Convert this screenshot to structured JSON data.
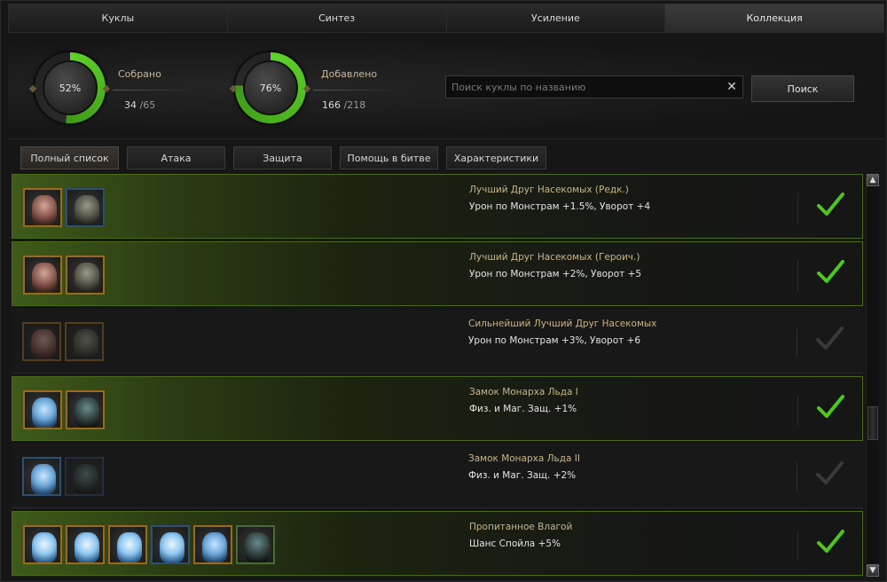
{
  "tabs": [
    {
      "label": "Куклы"
    },
    {
      "label": "Синтез"
    },
    {
      "label": "Усиление"
    },
    {
      "label": "Коллекция"
    }
  ],
  "stats": {
    "collected": {
      "percent_label": "52%",
      "label": "Собрано",
      "current": "34",
      "total": "/65",
      "fraction": 0.52
    },
    "added": {
      "percent_label": "76%",
      "label": "Добавлено",
      "current": "166",
      "total": "/218",
      "fraction": 0.76
    }
  },
  "search": {
    "placeholder": "Поиск куклы по названию",
    "value": "",
    "button_label": "Поиск",
    "clear_glyph": "✕"
  },
  "filters": [
    {
      "label": "Полный список"
    },
    {
      "label": "Атака"
    },
    {
      "label": "Защита"
    },
    {
      "label": "Помощь в битве"
    },
    {
      "label": "Характеристики"
    }
  ],
  "colors": {
    "accent_green": "#4b6a1c",
    "check_active": "#4ec81e",
    "title_gold": "#c9b48a"
  },
  "collections": [
    {
      "title": "Лучший Друг Насекомых (Редк.)",
      "desc": "Урон по Монстрам +1.5%, Уворот +4",
      "complete": true,
      "icons": [
        {
          "type": "bug",
          "frame": "gold"
        },
        {
          "type": "bug2",
          "frame": "blue"
        }
      ]
    },
    {
      "title": "Лучший Друг Насекомых (Героич.)",
      "desc": "Урон по Монстрам +2%, Уворот +5",
      "complete": true,
      "icons": [
        {
          "type": "bug",
          "frame": "gold"
        },
        {
          "type": "bug2",
          "frame": "gold"
        }
      ]
    },
    {
      "title": "Сильнейший Лучший Друг Насекомых",
      "desc": "Урон по Монстрам +3%, Уворот +6",
      "complete": false,
      "icons": [
        {
          "type": "bug",
          "frame": "gold",
          "dim": true
        },
        {
          "type": "bug2",
          "frame": "gold",
          "dim": true
        }
      ]
    },
    {
      "title": "Замок Монарха Льда I",
      "desc": "Физ. и Маг. Защ. +1%",
      "complete": true,
      "icons": [
        {
          "type": "ice2",
          "frame": "gold"
        },
        {
          "type": "dark",
          "frame": "gold"
        }
      ]
    },
    {
      "title": "Замок Монарха Льда II",
      "desc": "Физ. и Маг. Защ. +2%",
      "complete": false,
      "icons": [
        {
          "type": "ice2",
          "frame": "blue"
        },
        {
          "type": "dark",
          "frame": "blue",
          "dim": true
        }
      ]
    },
    {
      "title": "Пропитанное Влагой",
      "desc": "Шанс Спойла +5%",
      "complete": true,
      "icons": [
        {
          "type": "ice",
          "frame": "gold"
        },
        {
          "type": "ice",
          "frame": "gold"
        },
        {
          "type": "ice",
          "frame": "gold"
        },
        {
          "type": "ice",
          "frame": "blue"
        },
        {
          "type": "ice2",
          "frame": "gold"
        },
        {
          "type": "dark",
          "frame": "green"
        }
      ]
    }
  ],
  "scrollbar": {
    "up_glyph": "▲",
    "down_glyph": "▼"
  }
}
